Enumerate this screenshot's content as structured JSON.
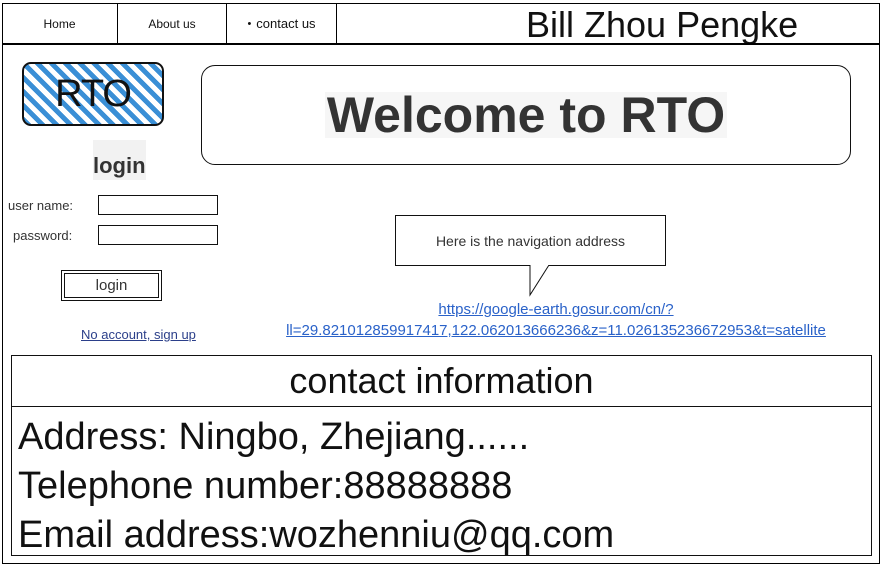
{
  "nav": {
    "items": [
      {
        "label": "Home"
      },
      {
        "label": "About us"
      },
      {
        "label": "contact us",
        "bullet": "•"
      }
    ]
  },
  "header": {
    "owner_name": "Bill Zhou Pengke"
  },
  "logo": {
    "text": "RTO",
    "stripe_color": "#3a8fd6"
  },
  "welcome": {
    "text": "Welcome to RTO"
  },
  "login": {
    "title": "login",
    "username_label": "user name:",
    "password_label": "password:",
    "username_value": "",
    "password_value": "",
    "button_label": "login",
    "signup_link": "No account, sign up"
  },
  "navigation": {
    "callout_text": "Here is the navigation address",
    "url_line1": "https://google-earth.gosur.com/cn/?",
    "url_line2": "ll=29.821012859917417,122.062013666236&z=11.026135236672953&t=satellite",
    "link_color": "#2a62c9"
  },
  "contact": {
    "title": "contact information",
    "address": "Address: Ningbo, Zhejiang......",
    "telephone": "Telephone number:88888888",
    "email": "Email address:wozhenniu@qq.com"
  }
}
